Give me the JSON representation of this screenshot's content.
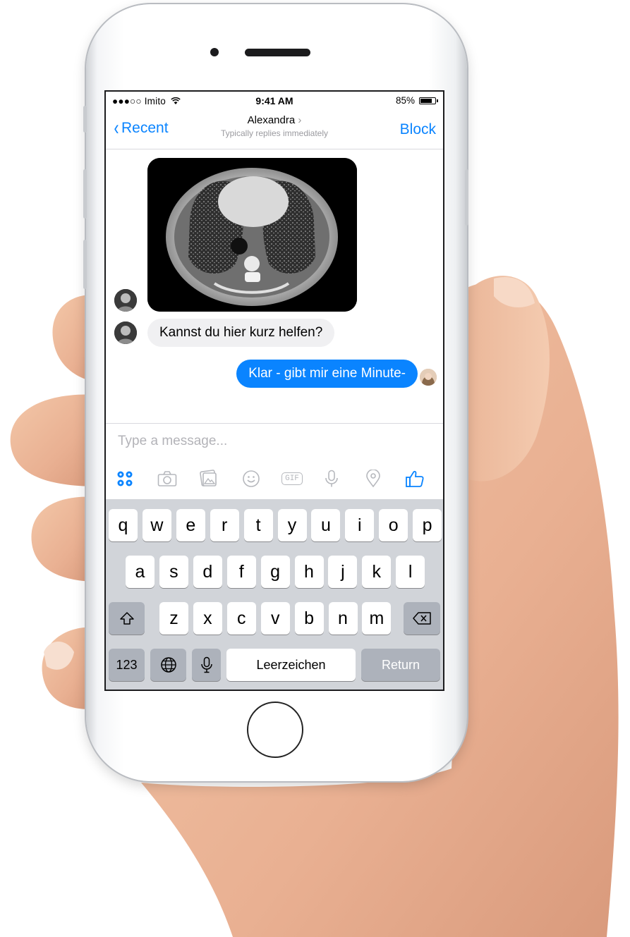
{
  "status_bar": {
    "carrier": "●●●○○ Imito",
    "time": "9:41 AM",
    "battery_percent": "85%",
    "battery_level": 0.85
  },
  "nav": {
    "back_label": "Recent",
    "contact_name": "Alexandra",
    "contact_subtitle": "Typically replies immediately",
    "block_label": "Block"
  },
  "messages": [
    {
      "sender": "incoming",
      "kind": "image",
      "icon": "ct-scan-image"
    },
    {
      "sender": "incoming",
      "kind": "text",
      "text": "Kannst du hier kurz helfen?"
    },
    {
      "sender": "outgoing",
      "kind": "text",
      "text": "Klar - gibt mir eine Minute-"
    }
  ],
  "composer": {
    "placeholder": "Type a message...",
    "tools": [
      "apps-icon",
      "camera-icon",
      "gallery-icon",
      "emoji-icon",
      "gif-icon",
      "microphone-icon",
      "location-icon",
      "like-icon"
    ],
    "gif_label": "GIF"
  },
  "keyboard": {
    "row1": [
      "q",
      "w",
      "e",
      "r",
      "t",
      "y",
      "u",
      "i",
      "o",
      "p"
    ],
    "row2": [
      "a",
      "s",
      "d",
      "f",
      "g",
      "h",
      "j",
      "k",
      "l"
    ],
    "row3": [
      "z",
      "x",
      "c",
      "v",
      "b",
      "n",
      "m"
    ],
    "numbers_label": "123",
    "space_label": "Leerzeichen",
    "return_label": "Return"
  },
  "colors": {
    "accent": "#0a84ff",
    "incoming_bubble": "#f0f0f2",
    "keyboard_bg": "#d1d4d9"
  }
}
